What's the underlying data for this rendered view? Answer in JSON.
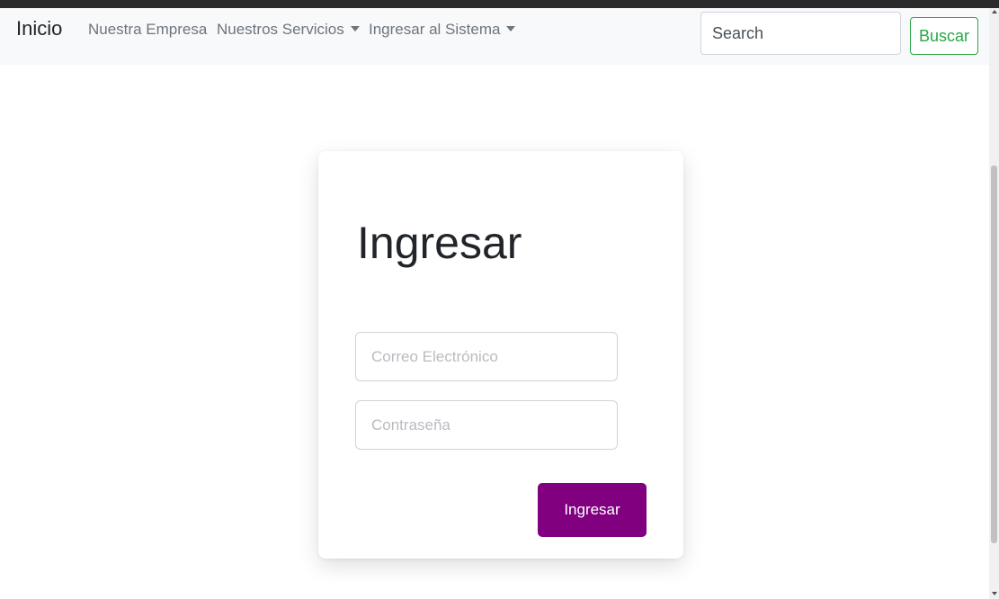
{
  "navbar": {
    "brand": "Inicio",
    "links": [
      {
        "label": "Nuestra Empresa",
        "dropdown": false
      },
      {
        "label": "Nuestros Servicios",
        "dropdown": true
      },
      {
        "label": "Ingresar al Sistema",
        "dropdown": true
      }
    ],
    "search": {
      "placeholder": "Search",
      "value": "",
      "button_label": "Buscar"
    }
  },
  "login": {
    "title": "Ingresar",
    "email_placeholder": "Correo Electrónico",
    "password_placeholder": "Contraseña",
    "submit_label": "Ingresar"
  },
  "colors": {
    "navbar_bg": "#f8f9fa",
    "submit_button": "#800080",
    "search_button_outline": "#28a745"
  },
  "icons": {
    "dropdown": "caret-down-icon"
  }
}
